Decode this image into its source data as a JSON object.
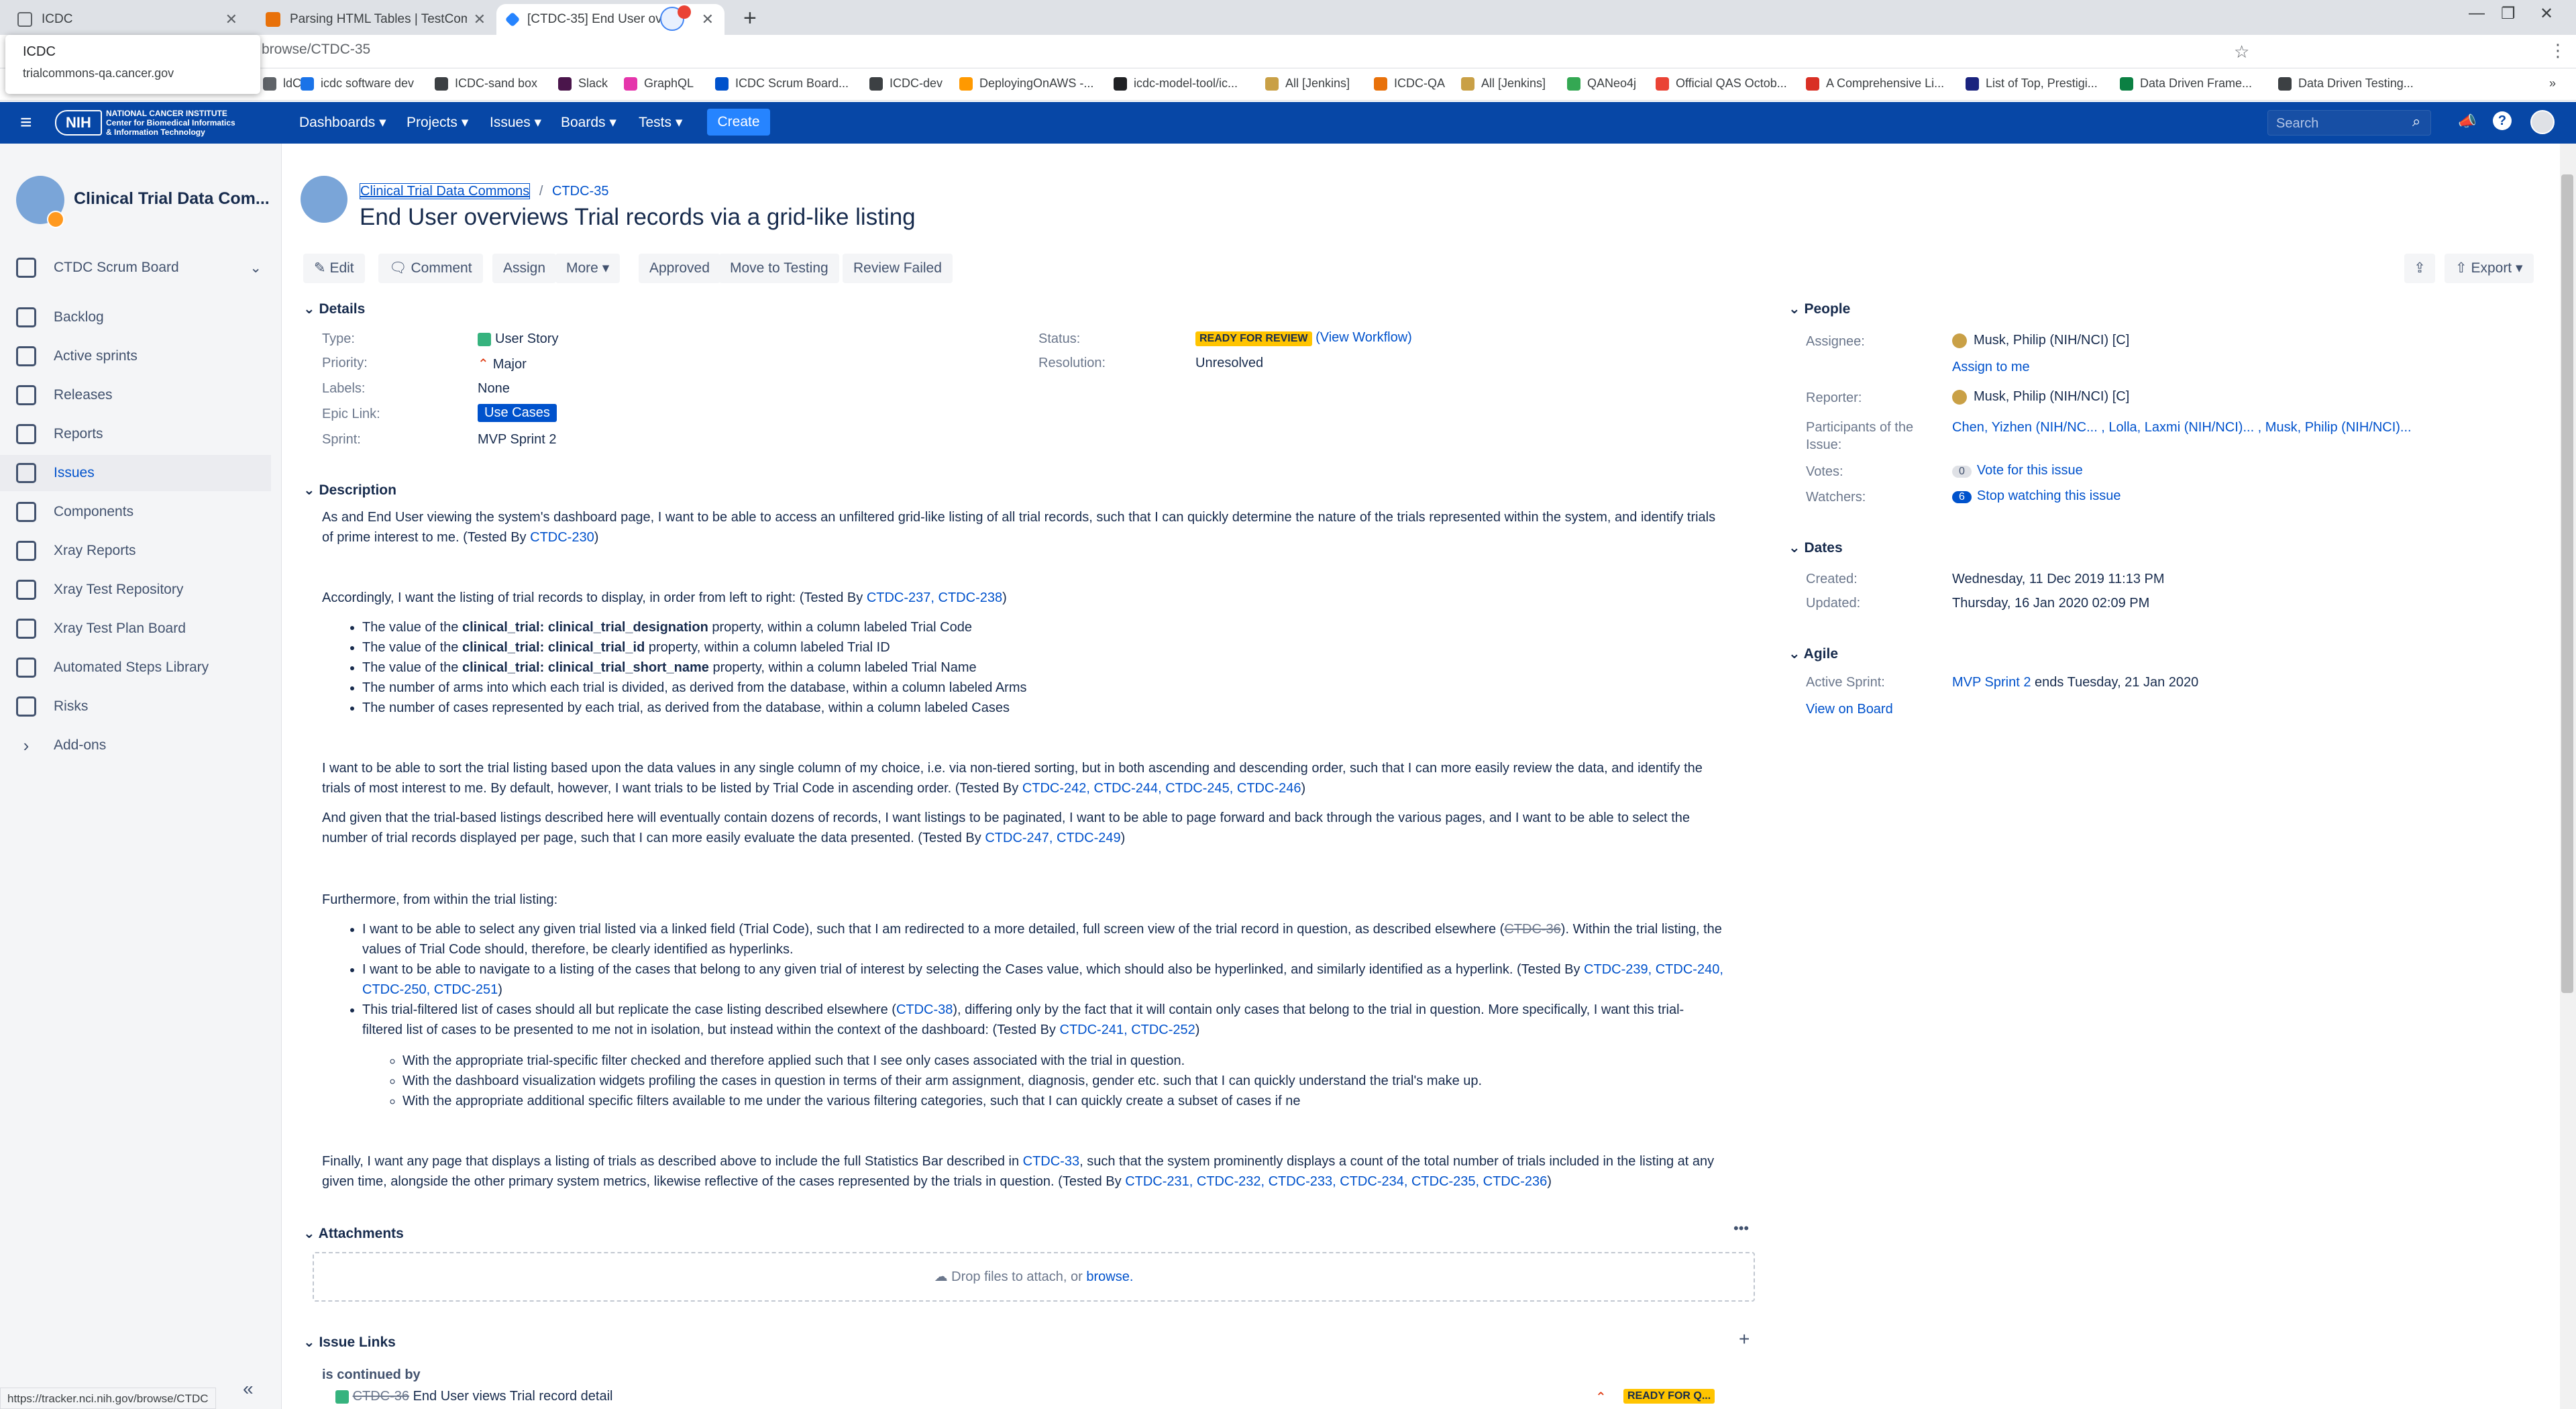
{
  "browser": {
    "tabs": [
      {
        "title": "ICDC"
      },
      {
        "title": "Parsing HTML Tables | TestComp..."
      },
      {
        "title": "[CTDC-35] End User ove"
      }
    ],
    "tooltip": {
      "title": "ICDC",
      "url": "trialcommons-qa.cancer.gov"
    },
    "url": "browse/CTDC-35",
    "bookmarks": [
      "ldC",
      "icdc software dev",
      "ICDC-sand box",
      "Slack",
      "GraphQL",
      "ICDC Scrum Board...",
      "ICDC-dev",
      "DeployingOnAWS -...",
      "icdc-model-tool/ic...",
      "All [Jenkins]",
      "ICDC-QA",
      "All [Jenkins]",
      "QANeo4j",
      "Official QAS Octob...",
      "A Comprehensive Li...",
      "List of Top, Prestigi...",
      "Data Driven Frame...",
      "Data Driven Testing..."
    ],
    "status_url": "https://tracker.nci.nih.gov/browse/CTDC"
  },
  "header": {
    "org_line1": "NATIONAL CANCER INSTITUTE",
    "org_line2": "Center for Biomedical Informatics",
    "org_line3": "& Information Technology",
    "nih": "NIH",
    "nav": [
      "Dashboards",
      "Projects",
      "Issues",
      "Boards",
      "Tests"
    ],
    "create": "Create",
    "search_placeholder": "Search",
    "accent": "#0747a6"
  },
  "sidebar": {
    "project_name": "Clinical Trial Data Com...",
    "board_name": "CTDC Scrum Board",
    "items": [
      {
        "label": "Backlog",
        "icon": "backlog-icon"
      },
      {
        "label": "Active sprints",
        "icon": "sprint-icon"
      },
      {
        "label": "Releases",
        "icon": "release-icon"
      },
      {
        "label": "Reports",
        "icon": "reports-icon"
      },
      {
        "label": "Issues",
        "icon": "issues-icon"
      },
      {
        "label": "Components",
        "icon": "components-icon"
      },
      {
        "label": "Xray Reports",
        "icon": "xray-reports-icon"
      },
      {
        "label": "Xray Test Repository",
        "icon": "xray-repo-icon"
      },
      {
        "label": "Xray Test Plan Board",
        "icon": "xray-plan-icon"
      },
      {
        "label": "Automated Steps Library",
        "icon": "steps-library-icon"
      },
      {
        "label": "Risks",
        "icon": "risks-icon"
      },
      {
        "label": "Add-ons",
        "icon": "addons-icon"
      }
    ]
  },
  "issue": {
    "breadcrumb_project": "Clinical Trial Data Commons",
    "breadcrumb_sep": "/",
    "breadcrumb_key": "CTDC-35",
    "title": "End User overviews Trial records via a grid-like listing",
    "actions": {
      "edit": "Edit",
      "comment": "Comment",
      "assign": "Assign",
      "more": "More",
      "approved": "Approved",
      "move": "Move to Testing",
      "review": "Review Failed",
      "export": "Export"
    },
    "details": {
      "heading": "Details",
      "type_label": "Type:",
      "type": "User Story",
      "priority_label": "Priority:",
      "priority": "Major",
      "labels_label": "Labels:",
      "labels": "None",
      "epic_label": "Epic Link:",
      "epic": "Use Cases",
      "sprint_label": "Sprint:",
      "sprint": "MVP Sprint 2",
      "status_label": "Status:",
      "status": "READY FOR REVIEW",
      "workflow": "(View Workflow)",
      "resolution_label": "Resolution:",
      "resolution": "Unresolved"
    },
    "description": {
      "heading": "Description",
      "p1": "As and End User viewing the system's dashboard page, I want to be able to access an unfiltered grid-like listing of all trial records, such that I can quickly determine the nature of the trials represented within the system, and identify trials of prime interest to me. (Tested By ",
      "p1_link": "CTDC-230",
      "p2": "Accordingly, I want the listing of trial records to display, in order from left to right: (Tested By ",
      "p2_links": "CTDC-237, CTDC-238",
      "bullets1": [
        {
          "pre": "The value of the ",
          "bold": "clinical_trial: clinical_trial_designation",
          "post": " property, within a column labeled Trial Code"
        },
        {
          "pre": "The value of the ",
          "bold": "clinical_trial: clinical_trial_id",
          "post": " property, within a column labeled Trial ID"
        },
        {
          "pre": "The value of the ",
          "bold": "clinical_trial: clinical_trial_short_name",
          "post": " property, within a column labeled Trial Name"
        },
        {
          "pre": "The number of arms into which each trial is divided, as derived from the database, within a column labeled Arms",
          "bold": "",
          "post": ""
        },
        {
          "pre": "The number of cases represented by each trial, as derived from the database, within a column labeled Cases",
          "bold": "",
          "post": ""
        }
      ],
      "p3": "I want to be able to sort the trial listing based upon the data values in any single column of my choice, i.e. via non-tiered sorting, but in both ascending and descending order, such that I can more easily review the data, and identify the trials of most interest to me. By default, however, I want trials to be listed by Trial Code in ascending order. (Tested By ",
      "p3_links": "CTDC-242, CTDC-244, CTDC-245, CTDC-246",
      "p4": "And given that the trial-based listings described here will eventually contain dozens of records, I want listings to be paginated, I want to be able to page forward and back through the various pages, and I want to be able to select the number of trial records displayed per page, such that I can more easily evaluate the data presented. (Tested By ",
      "p4_links": "CTDC-247, CTDC-249",
      "p5": "Furthermore, from within the trial listing:",
      "b2_1a": "I want to be able to select any given trial listed via a linked field (Trial Code), such that I am redirected to a more detailed, full screen view of the trial record in question, as described elsewhere (",
      "b2_1link": "CTDC-36",
      "b2_1b": "). Within the trial listing, the values of Trial Code should, therefore, be clearly identified as hyperlinks.",
      "b2_2": "I want to be able to navigate to a listing of the cases that belong to any given trial of interest by selecting the Cases value, which should also be hyperlinked, and similarly identified as a hyperlink. (Tested By ",
      "b2_2links": "CTDC-239, CTDC-240, CTDC-250, CTDC-251",
      "b2_3a": "This trial-filtered list of cases should all but replicate the case listing described elsewhere (",
      "b2_3link": "CTDC-38",
      "b2_3b": "), differing only by the fact that it will contain only cases that belong to the trial in question. More specifically, I want this trial-filtered list of cases to be presented to me not in isolation, but instead within the context of the dashboard: (Tested By ",
      "b2_3links": "CTDC-241, CTDC-252",
      "sub": [
        "With the appropriate trial-specific filter checked and therefore applied such that I see only cases associated with the trial in question.",
        "With the dashboard visualization widgets profiling the cases in question in terms of their arm assignment, diagnosis, gender etc. such that I can quickly understand the trial's make up.",
        "With the appropriate additional specific filters available to me under the various filtering categories, such that I can quickly create a subset of cases if ne"
      ],
      "p6a": "Finally, I want any page that displays a listing of trials as described above to include the full Statistics Bar described in ",
      "p6link": "CTDC-33",
      "p6b": ", such that the system prominently displays a count of the total number of trials included in the listing at any given time, alongside the other primary system metrics, likewise reflective of the cases represented by the trials in question. (Tested By ",
      "p6links": "CTDC-231, CTDC-232, CTDC-233, CTDC-234, CTDC-235, CTDC-236"
    },
    "attachments": {
      "heading": "Attachments",
      "drop": "Drop files to attach, or ",
      "browse": "browse."
    },
    "links": {
      "heading": "Issue Links",
      "relation": "is continued by",
      "key": "CTDC-36",
      "summary": "End User views Trial record detail",
      "status": "READY FOR Q..."
    },
    "people": {
      "heading": "People",
      "assignee_label": "Assignee:",
      "assignee": "Musk, Philip (NIH/NCI) [C]",
      "assign_me": "Assign to me",
      "reporter_label": "Reporter:",
      "reporter": "Musk, Philip (NIH/NCI) [C]",
      "participants_label": "Participants of the Issue:",
      "participants": "Chen, Yizhen (NIH/NC... , Lolla, Laxmi (NIH/NCI)... , Musk, Philip (NIH/NCI)...",
      "votes_label": "Votes:",
      "votes_count": "0",
      "votes_link": "Vote for this issue",
      "watchers_label": "Watchers:",
      "watchers_count": "6",
      "watchers_link": "Stop watching this issue"
    },
    "dates": {
      "heading": "Dates",
      "created_label": "Created:",
      "created": "Wednesday, 11 Dec 2019 11:13 PM",
      "updated_label": "Updated:",
      "updated": "Thursday, 16 Jan 2020 02:09 PM"
    },
    "agile": {
      "heading": "Agile",
      "sprint_label": "Active Sprint:",
      "sprint": "MVP Sprint 2",
      "sprint_ends": " ends Tuesday, 21 Jan 2020",
      "board": "View on Board"
    }
  }
}
